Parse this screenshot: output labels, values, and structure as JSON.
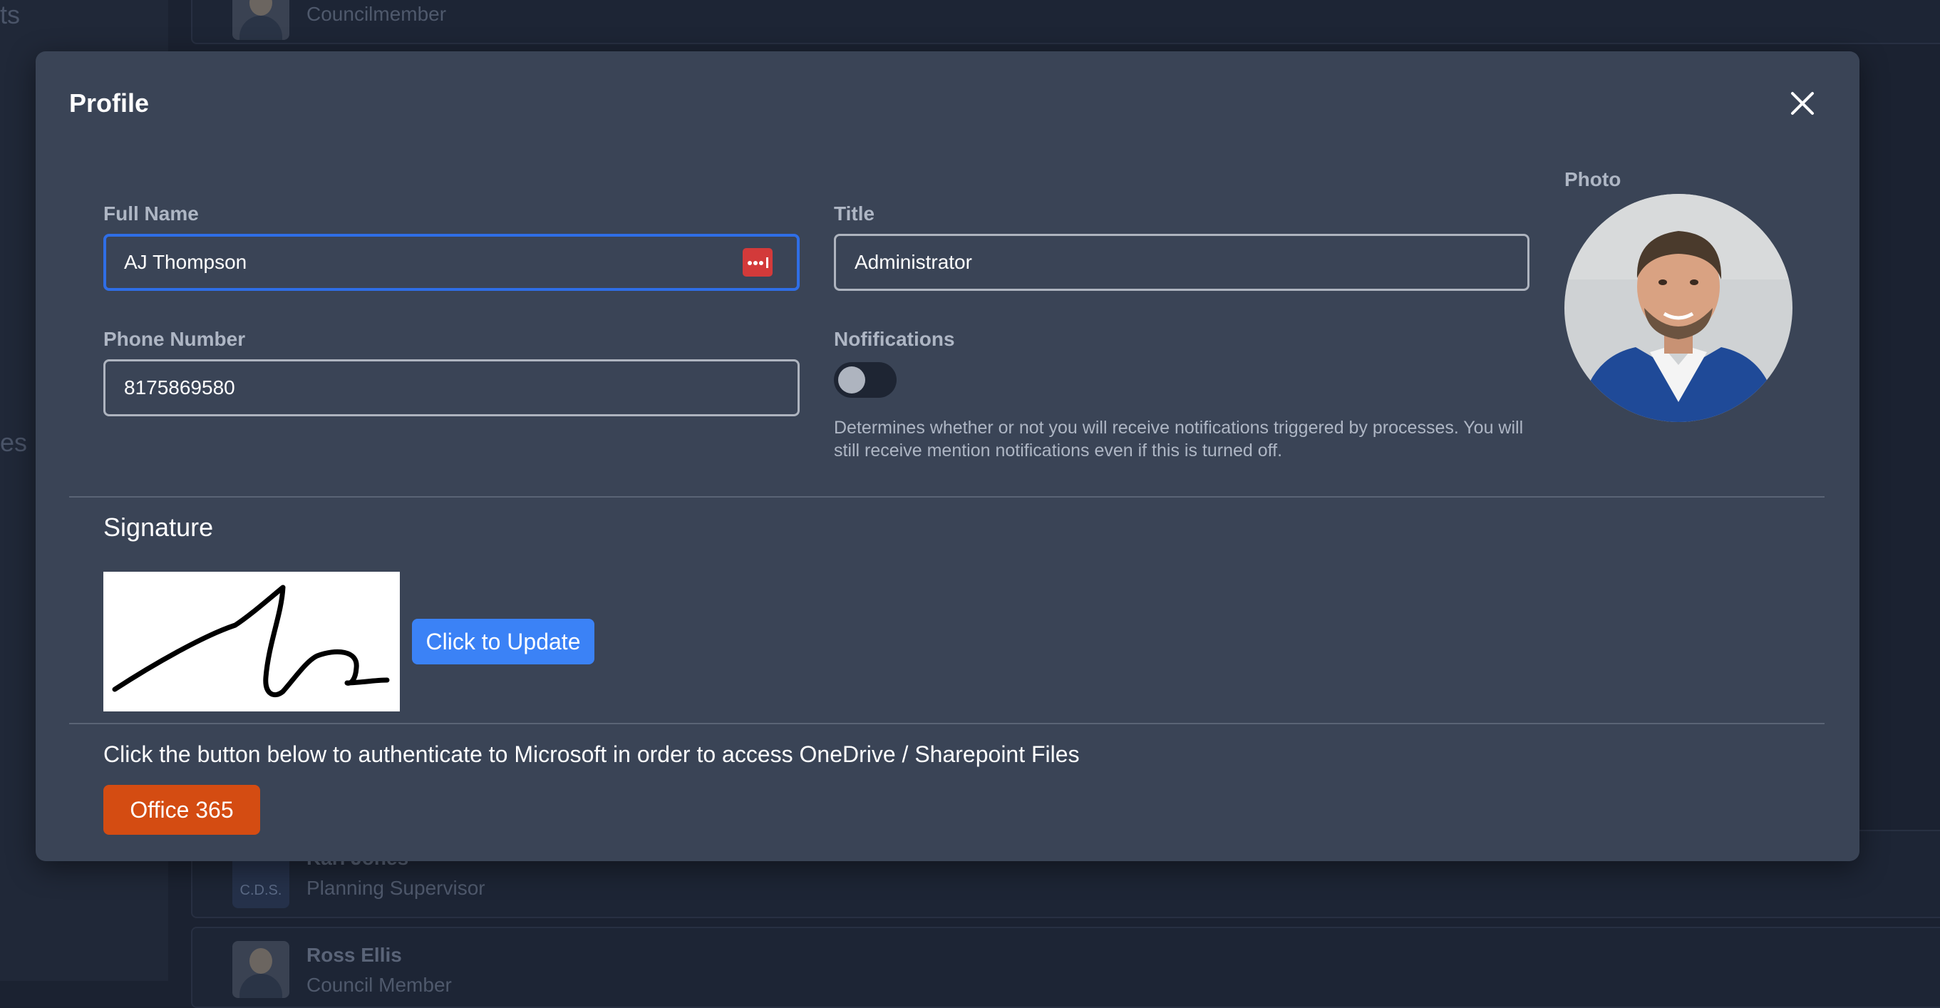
{
  "background": {
    "sidebar_fragments": [
      "ts",
      "es"
    ],
    "rows": [
      {
        "name": "",
        "subtitle": "Councilmember"
      },
      {
        "name": "Kari Jones",
        "subtitle": "Planning Supervisor",
        "avatar_text": "C.D.S."
      },
      {
        "name": "Ross Ellis",
        "subtitle": "Council Member"
      }
    ]
  },
  "modal": {
    "title": "Profile",
    "close_icon": "close-icon",
    "full_name": {
      "label": "Full Name",
      "value": "AJ Thompson"
    },
    "title_field": {
      "label": "Title",
      "value": "Administrator"
    },
    "phone": {
      "label": "Phone Number",
      "value": "8175869580"
    },
    "notifications": {
      "label": "Nofifications",
      "enabled": false,
      "help": "Determines whether or not you will receive notifications triggered by processes. You will still receive mention notifications even if this is turned off."
    },
    "photo": {
      "label": "Photo"
    },
    "signature": {
      "heading": "Signature",
      "update_label": "Click to Update"
    },
    "microsoft": {
      "text": "Click the button below to authenticate to Microsoft in order to access OneDrive / Sharepoint Files",
      "button_label": "Office 365"
    }
  },
  "colors": {
    "focus_border": "#2f6ee6",
    "update_button": "#3b82f6",
    "office_button": "#d44c12",
    "modal_bg": "#3a4456"
  }
}
